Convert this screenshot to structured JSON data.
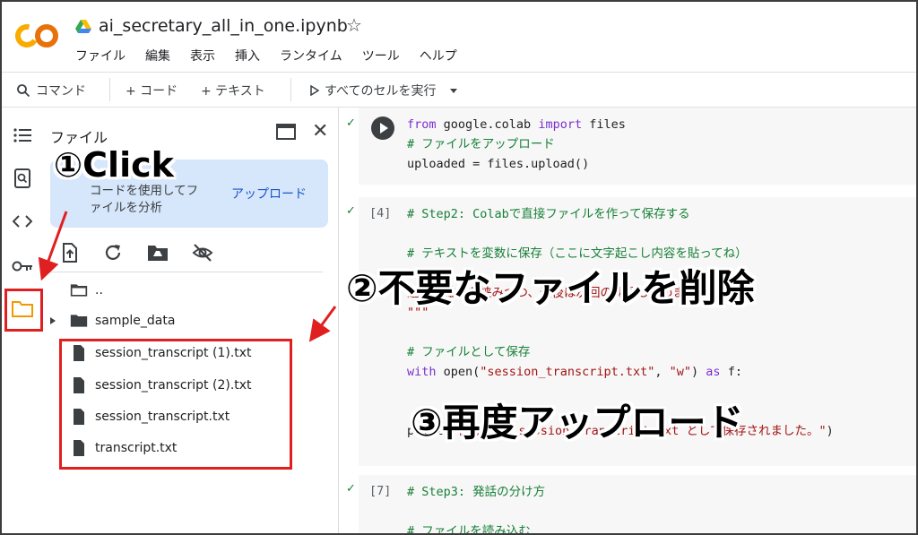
{
  "header": {
    "logo_text": "CO",
    "notebook_title": "ai_secretary_all_in_one.ipynb",
    "star_glyph": "☆",
    "menu": [
      "ファイル",
      "編集",
      "表示",
      "挿入",
      "ランタイム",
      "ツール",
      "ヘルプ"
    ]
  },
  "toolbar": {
    "command_label": "コマンド",
    "add_code_label": "+ コード",
    "add_text_label": "+ テキスト",
    "run_all_label": "すべてのセルを実行"
  },
  "files_panel": {
    "title": "ファイル",
    "info_text": "コードを使用してファイルを分析",
    "upload_label": "アップロード",
    "parent_dir": "..",
    "folder": "sample_data",
    "files": [
      "session_transcript (1).txt",
      "session_transcript (2).txt",
      "session_transcript.txt",
      "transcript.txt"
    ]
  },
  "cells": {
    "cell1": {
      "line1_kw1": "from",
      "line1_mod": " google.colab ",
      "line1_kw2": "import",
      "line1_rest": " files",
      "line2": "# ファイルをアップロード",
      "line3": "uploaded = files.upload()"
    },
    "cell2": {
      "exec": "[4]",
      "line1": "# Step2: Colabで直接ファイルを作って保存する",
      "line2": "# テキストを変数に保存（ここに文字起こし内容を貼ってね）",
      "line3": "途中で雑談も挟みつつ、最後は次回の課題も決めました。",
      "line4": "\"\"\"",
      "line5": "# ファイルとして保存",
      "line6_kw": "with",
      "line6_a": " open(",
      "line6_s1": "\"session_transcript.txt\"",
      "line6_b": ", ",
      "line6_s2": "\"w\"",
      "line6_c": ") ",
      "line6_kw2": "as",
      "line6_d": " f:",
      "line7_a": "print(",
      "line7_s": "\"保存完了：session_transcript.txt として保存されました。\"",
      "line7_b": ")"
    },
    "cell3": {
      "exec": "[7]",
      "line1": "# Step3: 発話の分け方",
      "line2": "# ファイルを読み込む"
    }
  },
  "overlays": {
    "step1": "①Click",
    "step2": "②不要なファイルを削除",
    "step3": "③再度アップロード"
  },
  "colors": {
    "highlight_red": "#e02020",
    "info_bg": "#d6e6fb",
    "link_blue": "#1a57c8",
    "comment_green": "#188038",
    "keyword_purple": "#7b30d0",
    "string_red": "#a31515",
    "logo_orange": "#f9ab00",
    "logo_dark_orange": "#e8710a"
  }
}
